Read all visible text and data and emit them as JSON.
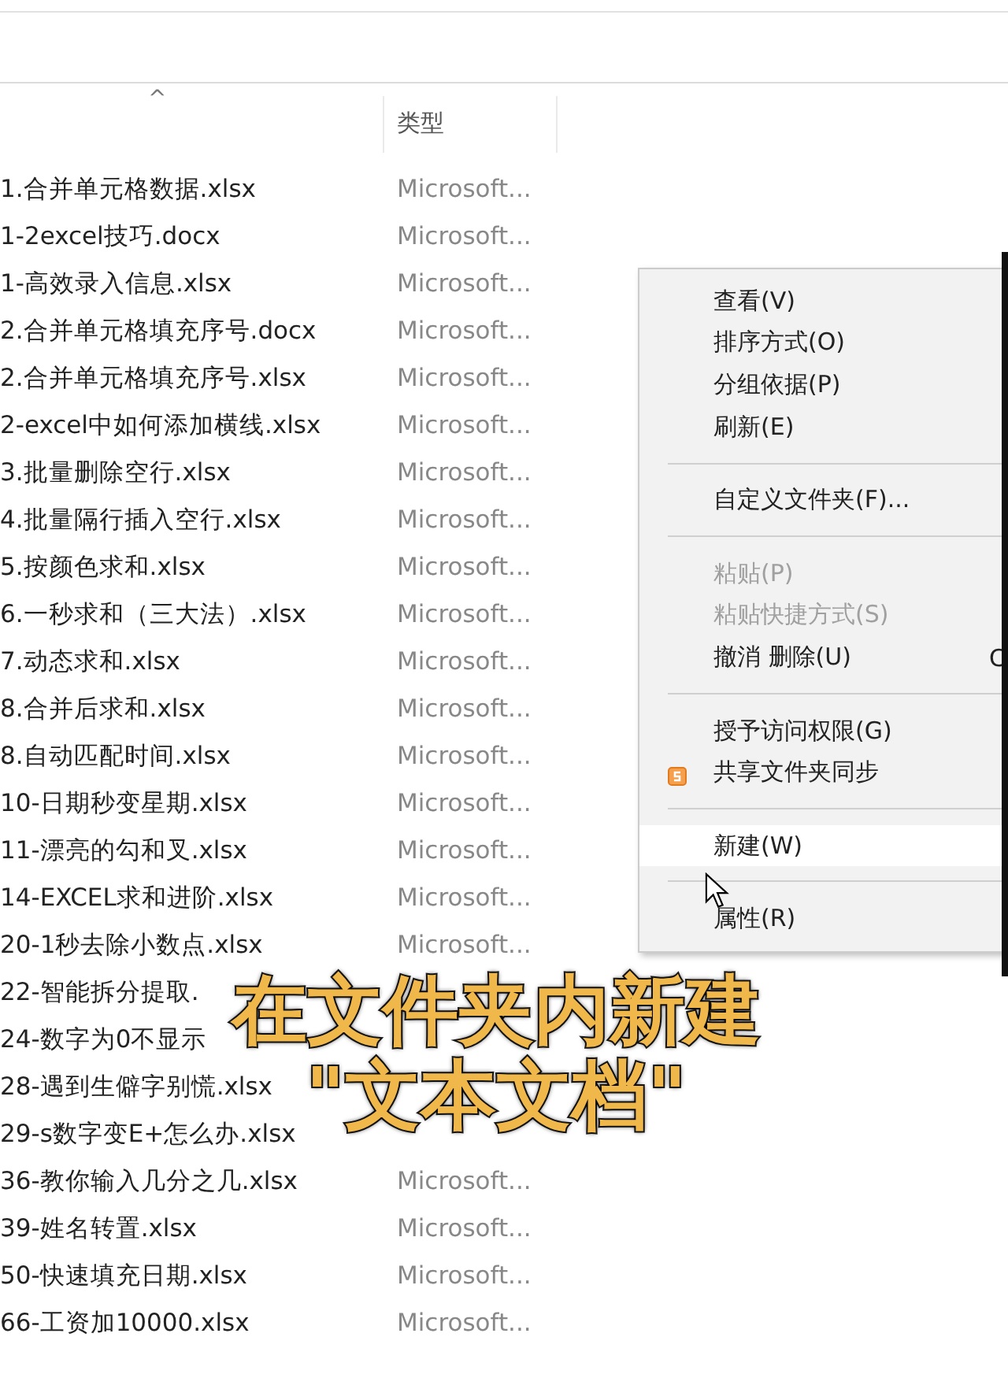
{
  "columns": [
    {
      "label": "类型",
      "sorted": false
    }
  ],
  "sort_indicator": "^",
  "files": [
    {
      "name": "1.合并单元格数据.xlsx",
      "type": "Microsoft..."
    },
    {
      "name": "1-2excel技巧.docx",
      "type": "Microsoft..."
    },
    {
      "name": "1-高效录入信息.xlsx",
      "type": "Microsoft..."
    },
    {
      "name": "2.合并单元格填充序号.docx",
      "type": "Microsoft..."
    },
    {
      "name": "2.合并单元格填充序号.xlsx",
      "type": "Microsoft..."
    },
    {
      "name": "2-excel中如何添加横线.xlsx",
      "type": "Microsoft..."
    },
    {
      "name": "3.批量删除空行.xlsx",
      "type": "Microsoft..."
    },
    {
      "name": "4.批量隔行插入空行.xlsx",
      "type": "Microsoft..."
    },
    {
      "name": "5.按颜色求和.xlsx",
      "type": "Microsoft..."
    },
    {
      "name": "6.一秒求和（三大法）.xlsx",
      "type": "Microsoft..."
    },
    {
      "name": "7.动态求和.xlsx",
      "type": "Microsoft..."
    },
    {
      "name": "8.合并后求和.xlsx",
      "type": "Microsoft..."
    },
    {
      "name": "8.自动匹配时间.xlsx",
      "type": "Microsoft..."
    },
    {
      "name": "10-日期秒变星期.xlsx",
      "type": "Microsoft..."
    },
    {
      "name": "11-漂亮的勾和叉.xlsx",
      "type": "Microsoft..."
    },
    {
      "name": "14-EXCEL求和进阶.xlsx",
      "type": "Microsoft..."
    },
    {
      "name": "20-1秒去除小数点.xlsx",
      "type": "Microsoft..."
    },
    {
      "name": "22-智能拆分提取."
    },
    {
      "name": "24-数字为0不显示"
    },
    {
      "name": "28-遇到生僻字别慌.xlsx"
    },
    {
      "name": "29-s数字变E+怎么办.xlsx"
    },
    {
      "name": "36-教你输入几分之几.xlsx",
      "type": "Microsoft..."
    },
    {
      "name": "39-姓名转置.xlsx",
      "type": "Microsoft..."
    },
    {
      "name": "50-快速填充日期.xlsx",
      "type": "Microsoft..."
    },
    {
      "name": "66-工资加10000.xlsx",
      "type": "Microsoft..."
    }
  ],
  "context_menu": {
    "items": [
      {
        "kind": "item",
        "label": "查看(V)",
        "disabled": false,
        "selected": false
      },
      {
        "kind": "item",
        "label": "排序方式(O)",
        "disabled": false,
        "selected": false
      },
      {
        "kind": "item",
        "label": "分组依据(P)",
        "disabled": false,
        "selected": false
      },
      {
        "kind": "item",
        "label": "刷新(E)",
        "disabled": false,
        "selected": false
      },
      {
        "kind": "separator"
      },
      {
        "kind": "item",
        "label": "自定义文件夹(F)...",
        "disabled": false,
        "selected": false
      },
      {
        "kind": "separator"
      },
      {
        "kind": "item",
        "label": "粘贴(P)",
        "disabled": true,
        "selected": false
      },
      {
        "kind": "item",
        "label": "粘贴快捷方式(S)",
        "disabled": true,
        "selected": false
      },
      {
        "kind": "item",
        "label": "撤消 删除(U)",
        "shortcut": "C",
        "disabled": false,
        "selected": false
      },
      {
        "kind": "separator"
      },
      {
        "kind": "item",
        "label": "授予访问权限(G)",
        "disabled": false,
        "selected": false
      },
      {
        "kind": "icon-item",
        "label": "共享文件夹同步",
        "disabled": false,
        "selected": false
      },
      {
        "kind": "separator"
      },
      {
        "kind": "item",
        "label": "新建(W)",
        "disabled": false,
        "selected": true
      },
      {
        "kind": "separator"
      },
      {
        "kind": "item",
        "label": "属性(R)",
        "disabled": false,
        "selected": false
      }
    ]
  },
  "caption": {
    "lines": [
      "在文件夹内新建",
      "\"文本文档\""
    ]
  }
}
